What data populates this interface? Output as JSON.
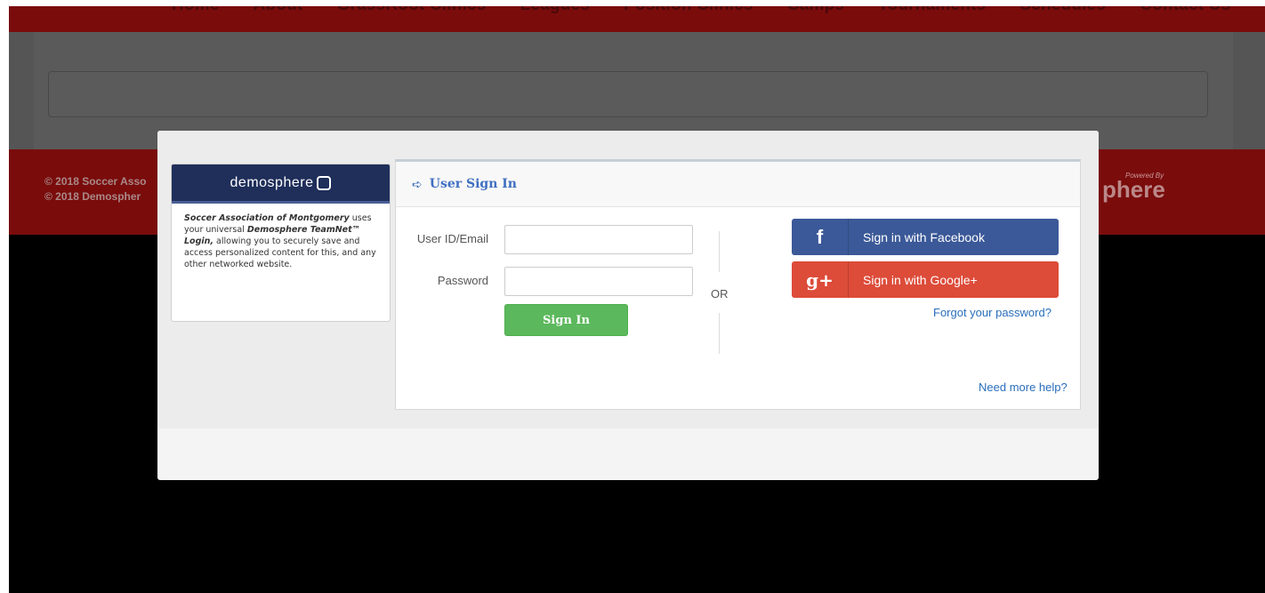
{
  "nav": {
    "items": [
      "Home",
      "About",
      "GrassRoot Clinics",
      "Leagues",
      "Position Clinics",
      "Camps",
      "Tournaments",
      "Schedules",
      "Contact Us"
    ]
  },
  "footer": {
    "copy_line1": "© 2018 Soccer Asso",
    "copy_line2": "© 2018 Demospher",
    "powered_by": "Powered By",
    "brand_partial": "phere"
  },
  "demosphere_card": {
    "brand": "demosphere",
    "org_name": "Soccer Association of Montgomery",
    "text_a": " uses your universal ",
    "product": "Demosphere TeamNet™ Login,",
    "text_b": " allowing you to securely save and access personalized content for this, and any other networked website."
  },
  "signin": {
    "title": "User Sign In",
    "user_label": "User ID/Email",
    "password_label": "Password",
    "user_value": "",
    "password_value": "",
    "signin_button": "Sign In",
    "or_text": "OR",
    "facebook_button": "Sign in with Facebook",
    "google_button": "Sign in with Google+",
    "forgot_link": "Forgot your password?",
    "help_link": "Need more help?"
  },
  "colors": {
    "facebook": "#3b5998",
    "google": "#dd4b39",
    "signin_green": "#5cb85c",
    "accent_blue": "#3f6fc0",
    "header_dark_red": "#7a0c0c"
  }
}
